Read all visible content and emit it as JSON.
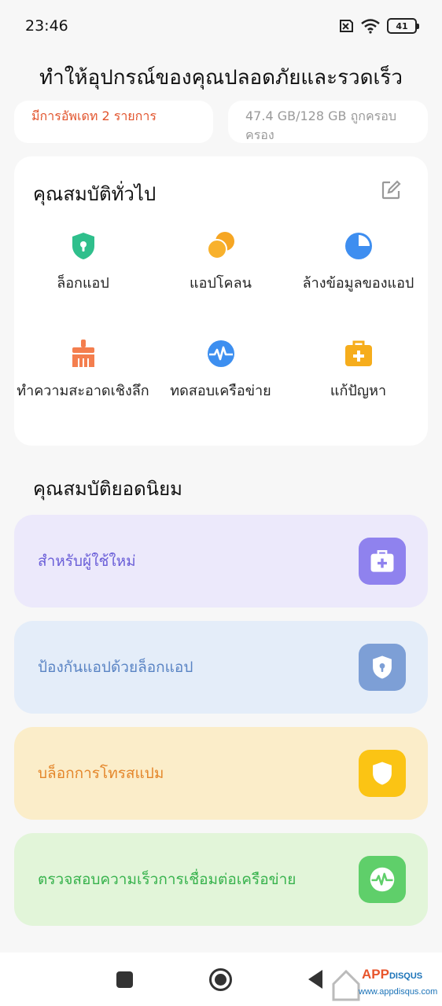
{
  "status_bar": {
    "time": "23:46",
    "battery": "41"
  },
  "page_title": "ทำให้อุปกรณ์ของคุณปลอดภัยและรวดเร็ว",
  "top_cards": {
    "updates": "มีการอัพเดท 2 รายการ",
    "storage": "47.4 GB/128 GB ถูกครอบครอง"
  },
  "general": {
    "title": "คุณสมบัติทั่วไป",
    "items": [
      {
        "label": "ล็อกแอป",
        "icon": "shield-lock-icon",
        "color": "#2fbf8c"
      },
      {
        "label": "แอปโคลน",
        "icon": "clone-circles-icon",
        "color": "#f6a623"
      },
      {
        "label": "ล้างข้อมูลของแอป",
        "icon": "pie-chart-icon",
        "color": "#3e8ef0"
      },
      {
        "label": "ทำความสะอาดเชิงลึก",
        "icon": "broom-icon",
        "color": "#f47e4e"
      },
      {
        "label": "ทดสอบเครือข่าย",
        "icon": "network-pulse-icon",
        "color": "#3d8ff0"
      },
      {
        "label": "แก้ปัญหา",
        "icon": "first-aid-icon",
        "color": "#f6ad1c"
      }
    ]
  },
  "popular": {
    "title": "คุณสมบัติยอดนิยม",
    "banners": [
      {
        "label": "สำหรับผู้ใช้ใหม่",
        "bg": "#ece9fb",
        "text_color": "#6a5ed8",
        "badge_color": "#8f82ee",
        "icon": "first-aid-icon"
      },
      {
        "label": "ป้องกันแอปด้วยล็อกแอป",
        "bg": "#e4edf9",
        "text_color": "#5a84c4",
        "badge_color": "#7d9fd6",
        "icon": "shield-lock-icon"
      },
      {
        "label": "บล็อกการโทรสแปม",
        "bg": "#fbedc9",
        "text_color": "#e4862a",
        "badge_color": "#fbc414",
        "icon": "shield-icon"
      },
      {
        "label": "ตรวจสอบความเร็วการเชื่อมต่อเครือข่าย",
        "bg": "#e2f5d9",
        "text_color": "#36b24c",
        "badge_color": "#5fcf6a",
        "icon": "network-pulse-icon"
      }
    ]
  },
  "watermark": {
    "brand_a": "APP",
    "brand_b": "DISQUS",
    "url": "www.appdisqus.com"
  }
}
